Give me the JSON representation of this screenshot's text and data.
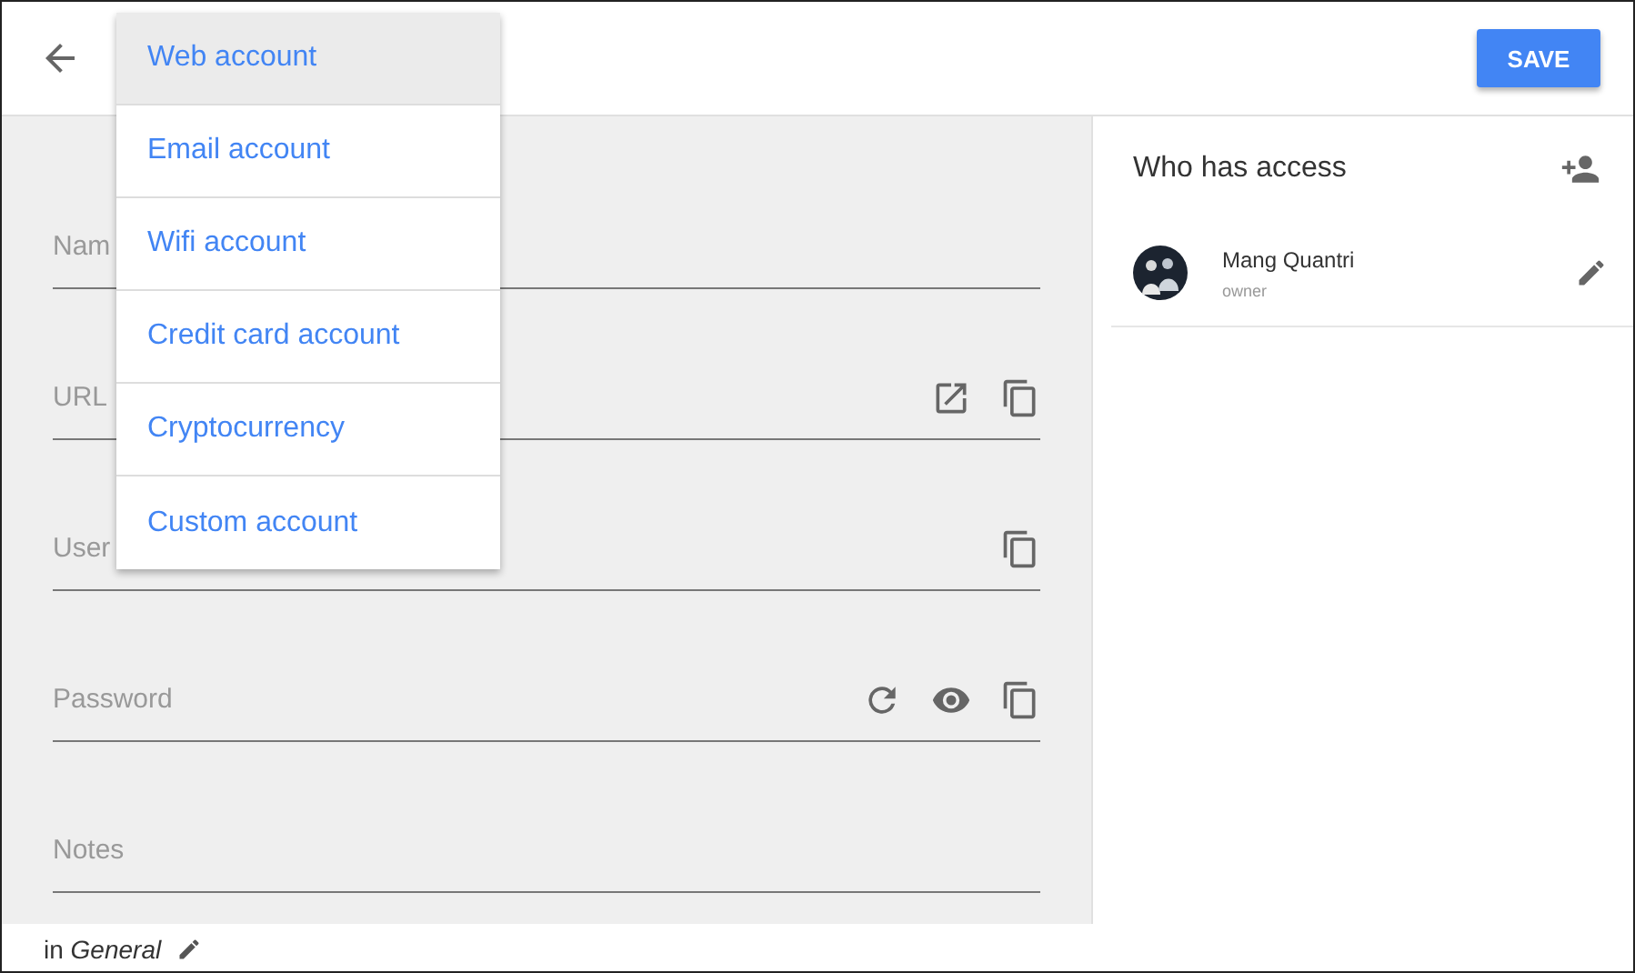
{
  "toolbar": {
    "save_button": "SAVE"
  },
  "type_menu": [
    {
      "label": "Web account",
      "selected": true
    },
    {
      "label": "Email account",
      "selected": false
    },
    {
      "label": "Wifi account",
      "selected": false
    },
    {
      "label": "Credit card account",
      "selected": false
    },
    {
      "label": "Cryptocurrency",
      "selected": false
    },
    {
      "label": "Custom account",
      "selected": false
    }
  ],
  "fields": [
    {
      "label": "Nam"
    },
    {
      "label": "URL",
      "open_link": true,
      "copy": true
    },
    {
      "label": "User",
      "copy": true
    },
    {
      "label": "Password",
      "generate": true,
      "reveal": true,
      "copy": true
    },
    {
      "label": "Notes"
    }
  ],
  "footer": {
    "folder": "in *General*"
  },
  "access": {
    "title": "Who has access",
    "members": [
      {
        "name": "Mang Quantri",
        "role": "owner"
      }
    ]
  }
}
